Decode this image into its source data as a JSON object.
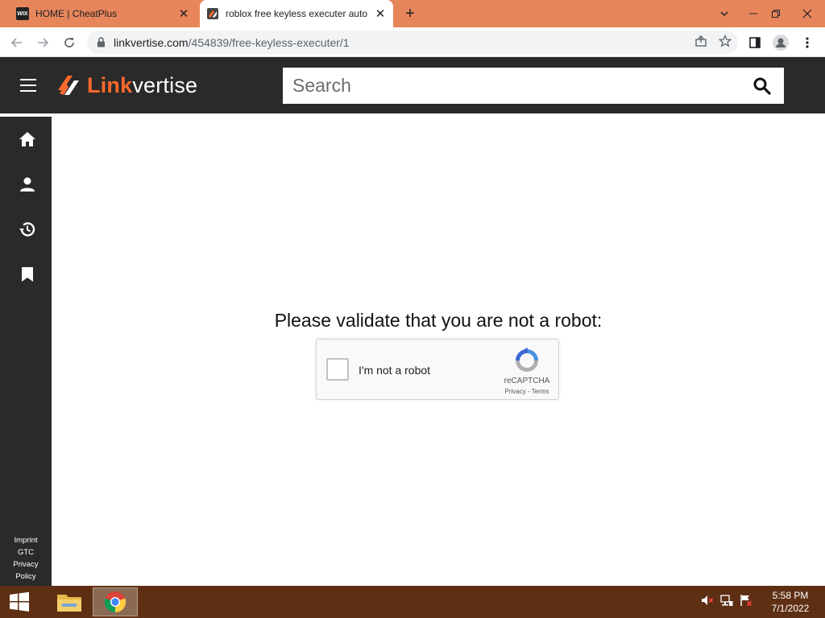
{
  "browser": {
    "tabs": [
      {
        "title": "HOME | CheatPlus",
        "favicon": "wix-icon",
        "active": false
      },
      {
        "title": "roblox free keyless executer auto",
        "favicon": "linkvertise-icon",
        "active": true
      }
    ],
    "url_host": "linkvertise.com",
    "url_path": "/454839/free-keyless-executer/1"
  },
  "header": {
    "logo_link": "Link",
    "logo_vertise": "vertise",
    "search_placeholder": "Search"
  },
  "sidebar": {
    "items": [
      {
        "icon": "home-icon"
      },
      {
        "icon": "user-icon"
      },
      {
        "icon": "history-icon"
      },
      {
        "icon": "bookmark-icon"
      }
    ],
    "footer": [
      "Imprint",
      "GTC",
      "Privacy",
      "Policy"
    ]
  },
  "main": {
    "title": "Please validate that you are not a robot:",
    "captcha": {
      "label": "I'm not a robot",
      "brand": "reCAPTCHA",
      "links": "Privacy - Terms"
    }
  },
  "taskbar": {
    "time": "5:58 PM",
    "date": "7/1/2022"
  },
  "colors": {
    "tabstrip": "#e7855b",
    "header_bg": "#2a2a2a",
    "brand_orange": "#ff6a2c",
    "taskbar": "#5e2f13"
  }
}
